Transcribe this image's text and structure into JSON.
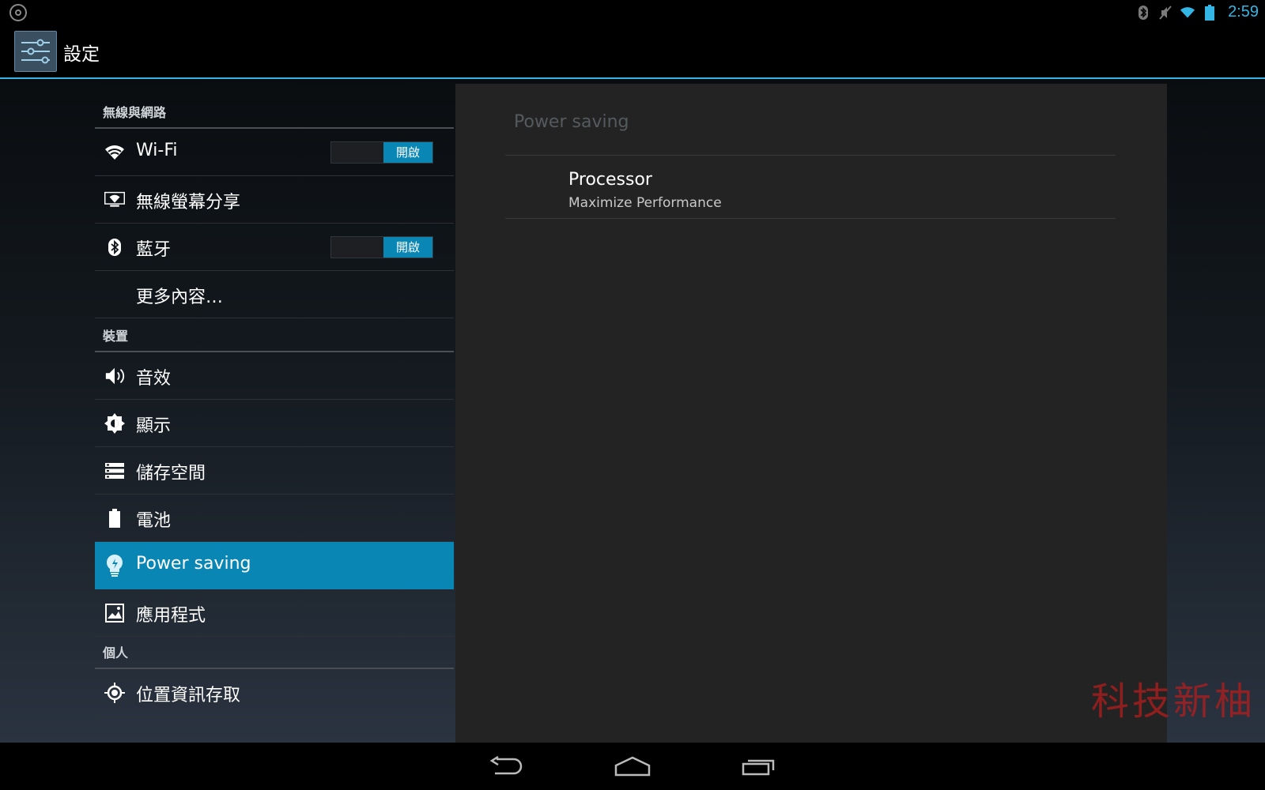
{
  "status_bar": {
    "left_icon": "notification-app-icon",
    "icons": [
      "bluetooth-icon",
      "mute-icon",
      "wifi-icon",
      "battery-icon"
    ],
    "time": "2:59",
    "accent_color": "#33b5e5"
  },
  "action_bar": {
    "title": "設定",
    "icon": "settings-sliders-icon"
  },
  "sidebar": {
    "headers": [
      "無線與網路",
      "裝置",
      "個人"
    ],
    "items": [
      {
        "label": "Wi-Fi",
        "icon": "wifi-icon",
        "toggle": "開啟"
      },
      {
        "label": "無線螢幕分享",
        "icon": "wireless-display-icon"
      },
      {
        "label": "藍牙",
        "icon": "bluetooth-icon",
        "toggle": "開啟"
      },
      {
        "label": "更多內容…",
        "icon": ""
      },
      {
        "label": "音效",
        "icon": "speaker-icon"
      },
      {
        "label": "顯示",
        "icon": "brightness-icon"
      },
      {
        "label": "儲存空間",
        "icon": "storage-icon"
      },
      {
        "label": "電池",
        "icon": "battery-icon"
      },
      {
        "label": "Power saving",
        "icon": "lightbulb-icon",
        "selected": true
      },
      {
        "label": "應用程式",
        "icon": "apps-icon"
      },
      {
        "label": "位置資訊存取",
        "icon": "location-icon"
      }
    ],
    "selected_color": "#0a86b5"
  },
  "detail": {
    "title": "Power saving",
    "preference": {
      "title": "Processor",
      "summary": "Maximize Performance"
    }
  },
  "watermark": "科技新柚",
  "nav_bar": {
    "buttons": [
      "back-icon",
      "home-icon",
      "recents-icon"
    ]
  }
}
